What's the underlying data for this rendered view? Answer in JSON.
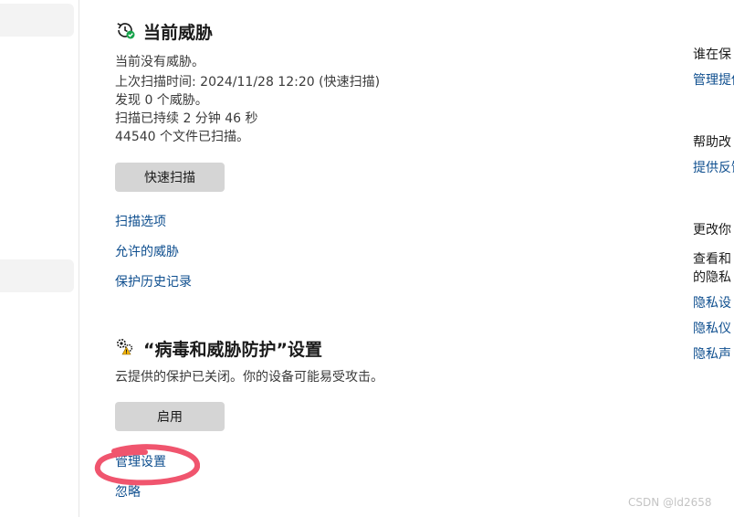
{
  "current_threats": {
    "title": "当前威胁",
    "lines": [
      "当前没有威胁。",
      "上次扫描时间: 2024/11/28 12:20 (快速扫描)",
      "发现 0 个威胁。",
      "扫描已持续 2 分钟 46 秒",
      "44540 个文件已扫描。"
    ],
    "quick_scan_label": "快速扫描",
    "links": [
      "扫描选项",
      "允许的威胁",
      "保护历史记录"
    ]
  },
  "settings": {
    "title": "“病毒和威胁防护”设置",
    "message": "云提供的保护已关闭。你的设备可能易受攻击。",
    "enable_label": "启用",
    "manage_label": "管理设置",
    "dismiss_label": "忽略"
  },
  "right_panel": {
    "heading1": "谁在保",
    "link1": "管理提供",
    "heading2": "帮助改",
    "link2": "提供反馈",
    "heading3": "更改你",
    "text3_line1": "查看和",
    "text3_line2": "的隐私",
    "links3": [
      "隐私设",
      "隐私仪",
      "隐私声"
    ]
  },
  "watermark": "CSDN @ld2658",
  "colors": {
    "link": "#0f4f8f",
    "button": "#d5d5d5",
    "annotation": "#f0556e",
    "status_ok": "#16a34a"
  },
  "icons": {
    "current_threats": "history-scan-icon",
    "settings": "gear-warning-icon"
  }
}
